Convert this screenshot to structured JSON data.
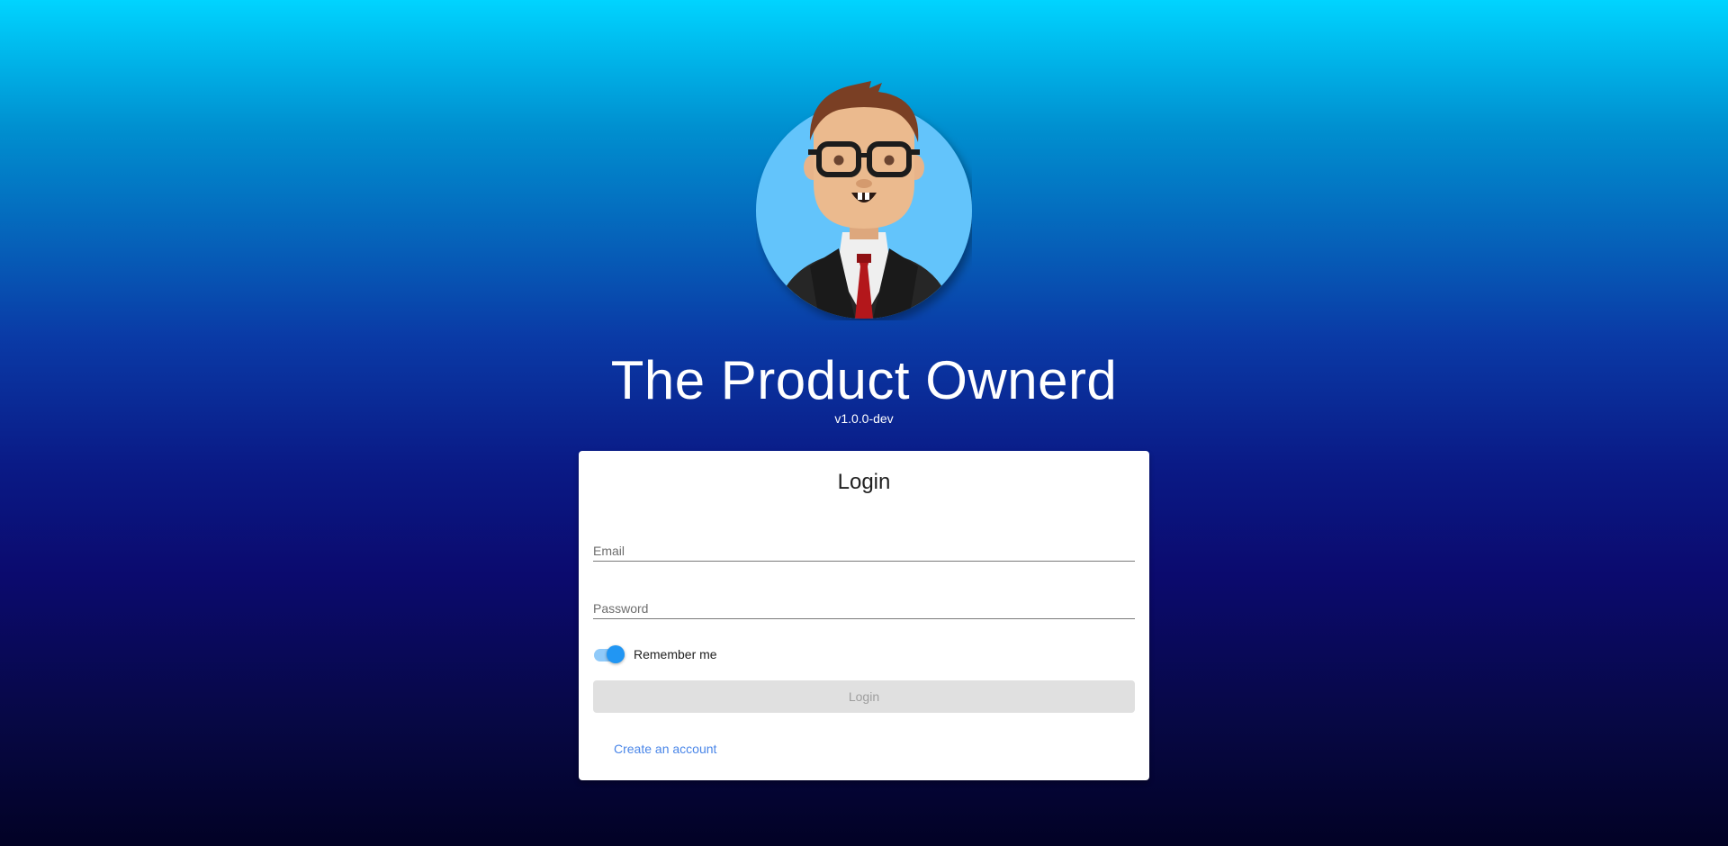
{
  "app": {
    "title": "The Product Ownerd",
    "version": "v1.0.0-dev"
  },
  "login_card": {
    "title": "Login",
    "email_placeholder": "Email",
    "email_value": "",
    "password_placeholder": "Password",
    "password_value": "",
    "remember_label": "Remember me",
    "remember_checked": true,
    "login_button_label": "Login",
    "login_button_disabled": true,
    "create_account_label": "Create an account"
  },
  "colors": {
    "gradient_top": "#00d4ff",
    "gradient_bottom": "#020225",
    "accent": "#2196f3",
    "link": "#4a86e8",
    "avatar_circle": "#64c4fb"
  },
  "icons": {
    "avatar": "product-owner-avatar-icon"
  }
}
